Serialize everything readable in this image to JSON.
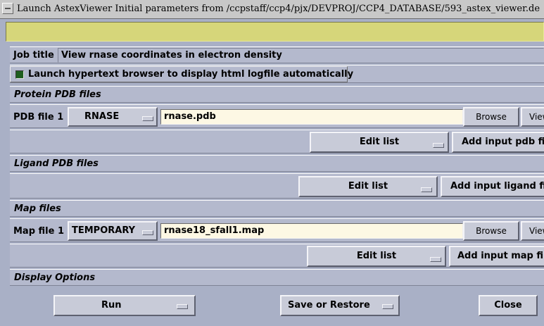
{
  "window": {
    "title": "Launch AstexViewer Initial parameters from /ccpstaff/ccp4/pjx/DEVPROJ/CCP4_DATABASE/593_astex_viewer.de"
  },
  "job": {
    "label": "Job title",
    "value": "View rnase coordinates in electron density",
    "browser_checkbox_label": "Launch hypertext browser to display html logfile automatically"
  },
  "protein": {
    "section_title": "Protein PDB files",
    "file_label": "PDB file 1",
    "directory": "RNASE",
    "filename": "rnase.pdb",
    "browse_label": "Browse",
    "view_label": "View",
    "edit_list_label": "Edit list",
    "add_label": "Add input pdb file"
  },
  "ligand": {
    "section_title": "Ligand PDB files",
    "edit_list_label": "Edit list",
    "add_label": "Add input ligand file"
  },
  "map": {
    "section_title": "Map files",
    "file_label": "Map file 1",
    "directory": "TEMPORARY",
    "filename": "rnase18_sfall1.map",
    "browse_label": "Browse",
    "view_label": "View",
    "edit_list_label": "Edit list",
    "add_label": "Add input map file"
  },
  "display": {
    "section_title": "Display Options"
  },
  "footer": {
    "run_label": "Run",
    "save_label": "Save or Restore",
    "close_label": "Close"
  }
}
